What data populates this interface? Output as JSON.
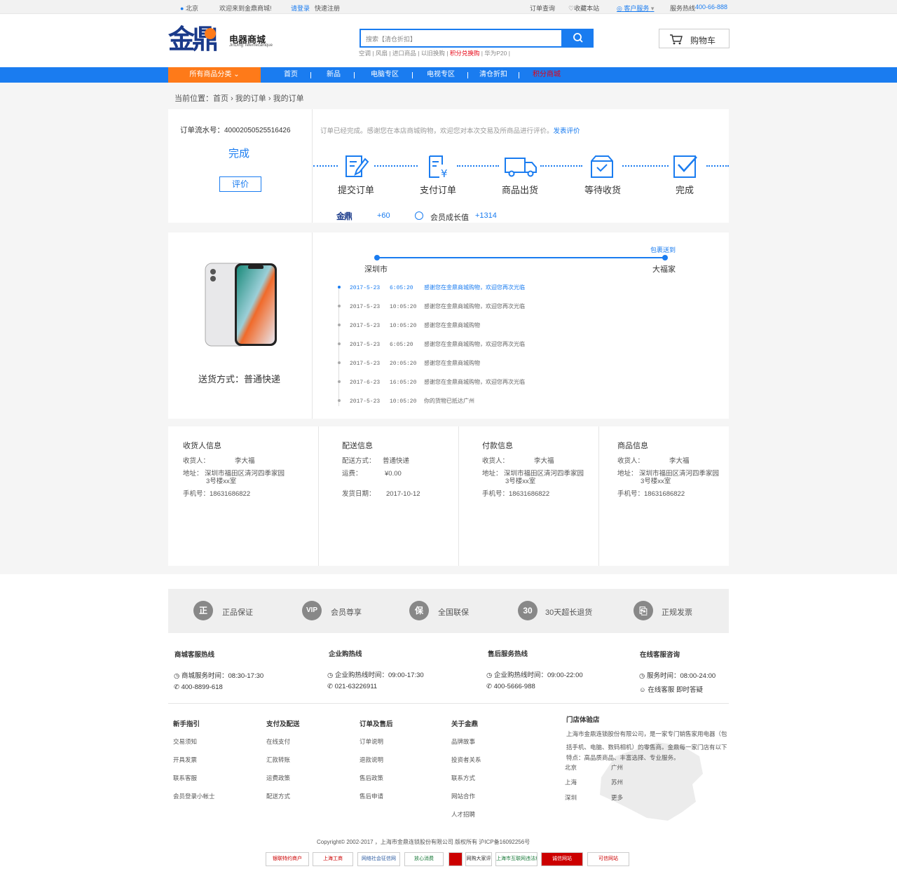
{
  "topbar": {
    "location": "北京",
    "welcome": "欢迎来到金鼎商城!",
    "login": "请登录",
    "register": "快速注册",
    "order_query": "订单查询",
    "favorite": "收藏本站",
    "service": "客户服务",
    "hotline_label": "服务热线",
    "hotline": "400-66-888"
  },
  "header": {
    "logo_cn": "电器商城",
    "logo_en": "JinDing Telemecanique",
    "logo_mark": "金鼎",
    "search_placeholder": "搜索【清仓折扣】",
    "hot_words": [
      "空调",
      "风扇",
      "进口商品",
      "以旧换购",
      "积分兑换购",
      "华为P20"
    ],
    "cart": "购物车"
  },
  "nav": {
    "category": "所有商品分类",
    "items": [
      "首页",
      "新品",
      "电脑专区",
      "电视专区",
      "清仓折扣",
      "积分商城"
    ]
  },
  "breadcrumb": {
    "prefix": "当前位置：",
    "items": [
      "首页",
      "我的订单",
      "我的订单"
    ]
  },
  "order": {
    "number_label": "订单流水号：",
    "number": "40002050525516426",
    "status": "完成",
    "review_button": "评价",
    "notice": "订单已经完成。感谢您在本店商城购物，欢迎您对本次交易及所商品进行评价。",
    "notice_link": "发表评价",
    "steps": [
      "提交订单",
      "支付订单",
      "商品出货",
      "等待收货",
      "完成"
    ],
    "points_value": "+60",
    "growth_label": "会员成长值",
    "growth_value": "+1314"
  },
  "shipping": {
    "delivery_label": "送货方式：普通快递",
    "from": "深圳市",
    "to": "大福家",
    "route_status": "包裹送到",
    "timeline": [
      {
        "date": "2017-5-23",
        "time": "6:05:20",
        "msg": "感谢您在金鼎商城购物，欢迎您再次光临",
        "active": true
      },
      {
        "date": "2017-5-23",
        "time": "10:05:20",
        "msg": "感谢您在金鼎商城购物，欢迎您再次光临"
      },
      {
        "date": "2017-5-23",
        "time": "10:05:20",
        "msg": "感谢您在金鼎商城购物"
      },
      {
        "date": "2017-5-23",
        "time": "6:05:20",
        "msg": "感谢您在金鼎商城购物，欢迎您再次光临"
      },
      {
        "date": "2017-5-23",
        "time": "20:05:20",
        "msg": "感谢您在金鼎商城购物"
      },
      {
        "date": "2017-6-23",
        "time": "16:05:20",
        "msg": "感谢您在金鼎商城购物，欢迎您再次光临"
      },
      {
        "date": "2017-5-23",
        "time": "10:05:20",
        "msg": "你的货物已抵达广州"
      }
    ]
  },
  "info": {
    "receiver": {
      "title": "收货人信息",
      "name_label": "收货人：",
      "name": "李大福",
      "addr_label": "地址：",
      "addr1": "深圳市福田区清河四季家园",
      "addr2": "3号楼xx室",
      "phone": "手机号：18631686822"
    },
    "delivery": {
      "title": "配送信息",
      "method_label": "配送方式：",
      "method": "普通快递",
      "fee_label": "运费：",
      "fee": "¥0.00",
      "date_label": "发货日期：",
      "date": "2017-10-12"
    },
    "payment": {
      "title": "付款信息",
      "name_label": "收货人：",
      "name": "李大福",
      "addr_label": "地址：",
      "addr1": "深圳市福田区清河四季家园",
      "addr2": "3号楼xx室",
      "phone": "手机号：18631686822"
    },
    "goods": {
      "title": "商品信息",
      "name_label": "收货人：",
      "name": "李大福",
      "addr_label": "地址：",
      "addr1": "深圳市福田区清河四季家园",
      "addr2": "3号楼xx室",
      "phone": "手机号：18631686822"
    }
  },
  "guarantees": [
    {
      "icon": "正",
      "label": "正品保证"
    },
    {
      "icon": "VIP",
      "label": "会员尊享"
    },
    {
      "icon": "保",
      "label": "全国联保"
    },
    {
      "icon": "30",
      "label": "30天超长退货"
    },
    {
      "icon": "invoice-icon",
      "label": "正规发票"
    }
  ],
  "hotlines": [
    {
      "title": "商城客服热线",
      "line1": "商城服务时间：08:30-17:30",
      "line2": "400-8899-618"
    },
    {
      "title": "企业购热线",
      "line1": "企业购热线时间：09:00-17:30",
      "line2": "021-63226911"
    },
    {
      "title": "售后服务热线",
      "line1": "企业购热线时间：09:00-22:00",
      "line2": "400-5666-988"
    },
    {
      "title": "在线客服咨询",
      "line1": "服务时间：08:00-24:00",
      "line2": "在线客服 即时答疑"
    }
  ],
  "footer_links": [
    {
      "title": "新手指引",
      "items": [
        "交易须知",
        "开具发票",
        "联系客服",
        "会员登录小帐士"
      ]
    },
    {
      "title": "支付及配送",
      "items": [
        "在线支付",
        "汇款转账",
        "运费政策",
        "配送方式"
      ]
    },
    {
      "title": "订单及售后",
      "items": [
        "订单说明",
        "退款说明",
        "售后政策",
        "售后申请"
      ]
    },
    {
      "title": "关于金鼎",
      "items": [
        "品牌故事",
        "投资者关系",
        "联系方式",
        "网站合作",
        "人才招聘"
      ]
    }
  ],
  "store": {
    "title": "门店体验店",
    "desc1": "上海市金鼎连锁股份有限公司，是一家专门销售家用电器（包",
    "desc2": "括手机、电脑、数码相机）的零售商。金鼎每一家门店有以下",
    "desc3": "特点：高品质商品、丰富选择、专业服务。",
    "cities": [
      "北京",
      "广州",
      "上海",
      "苏州",
      "深圳",
      "更多"
    ]
  },
  "copyright": "Copyright© 2002-2017 ，上海市金鼎连锁股份有限公司 版权所有 沪ICP备16092256号",
  "badges": [
    "银联特约商户",
    "上海工商",
    "网络社会征信网",
    "放心消费",
    "",
    "网购大家评",
    "上海市互联网违法和不良信息举报中心",
    "诚信网站",
    "可信网站"
  ],
  "colors": {
    "primary": "#1a7cf0",
    "orange": "#fe7a19",
    "red": "#e60012"
  }
}
